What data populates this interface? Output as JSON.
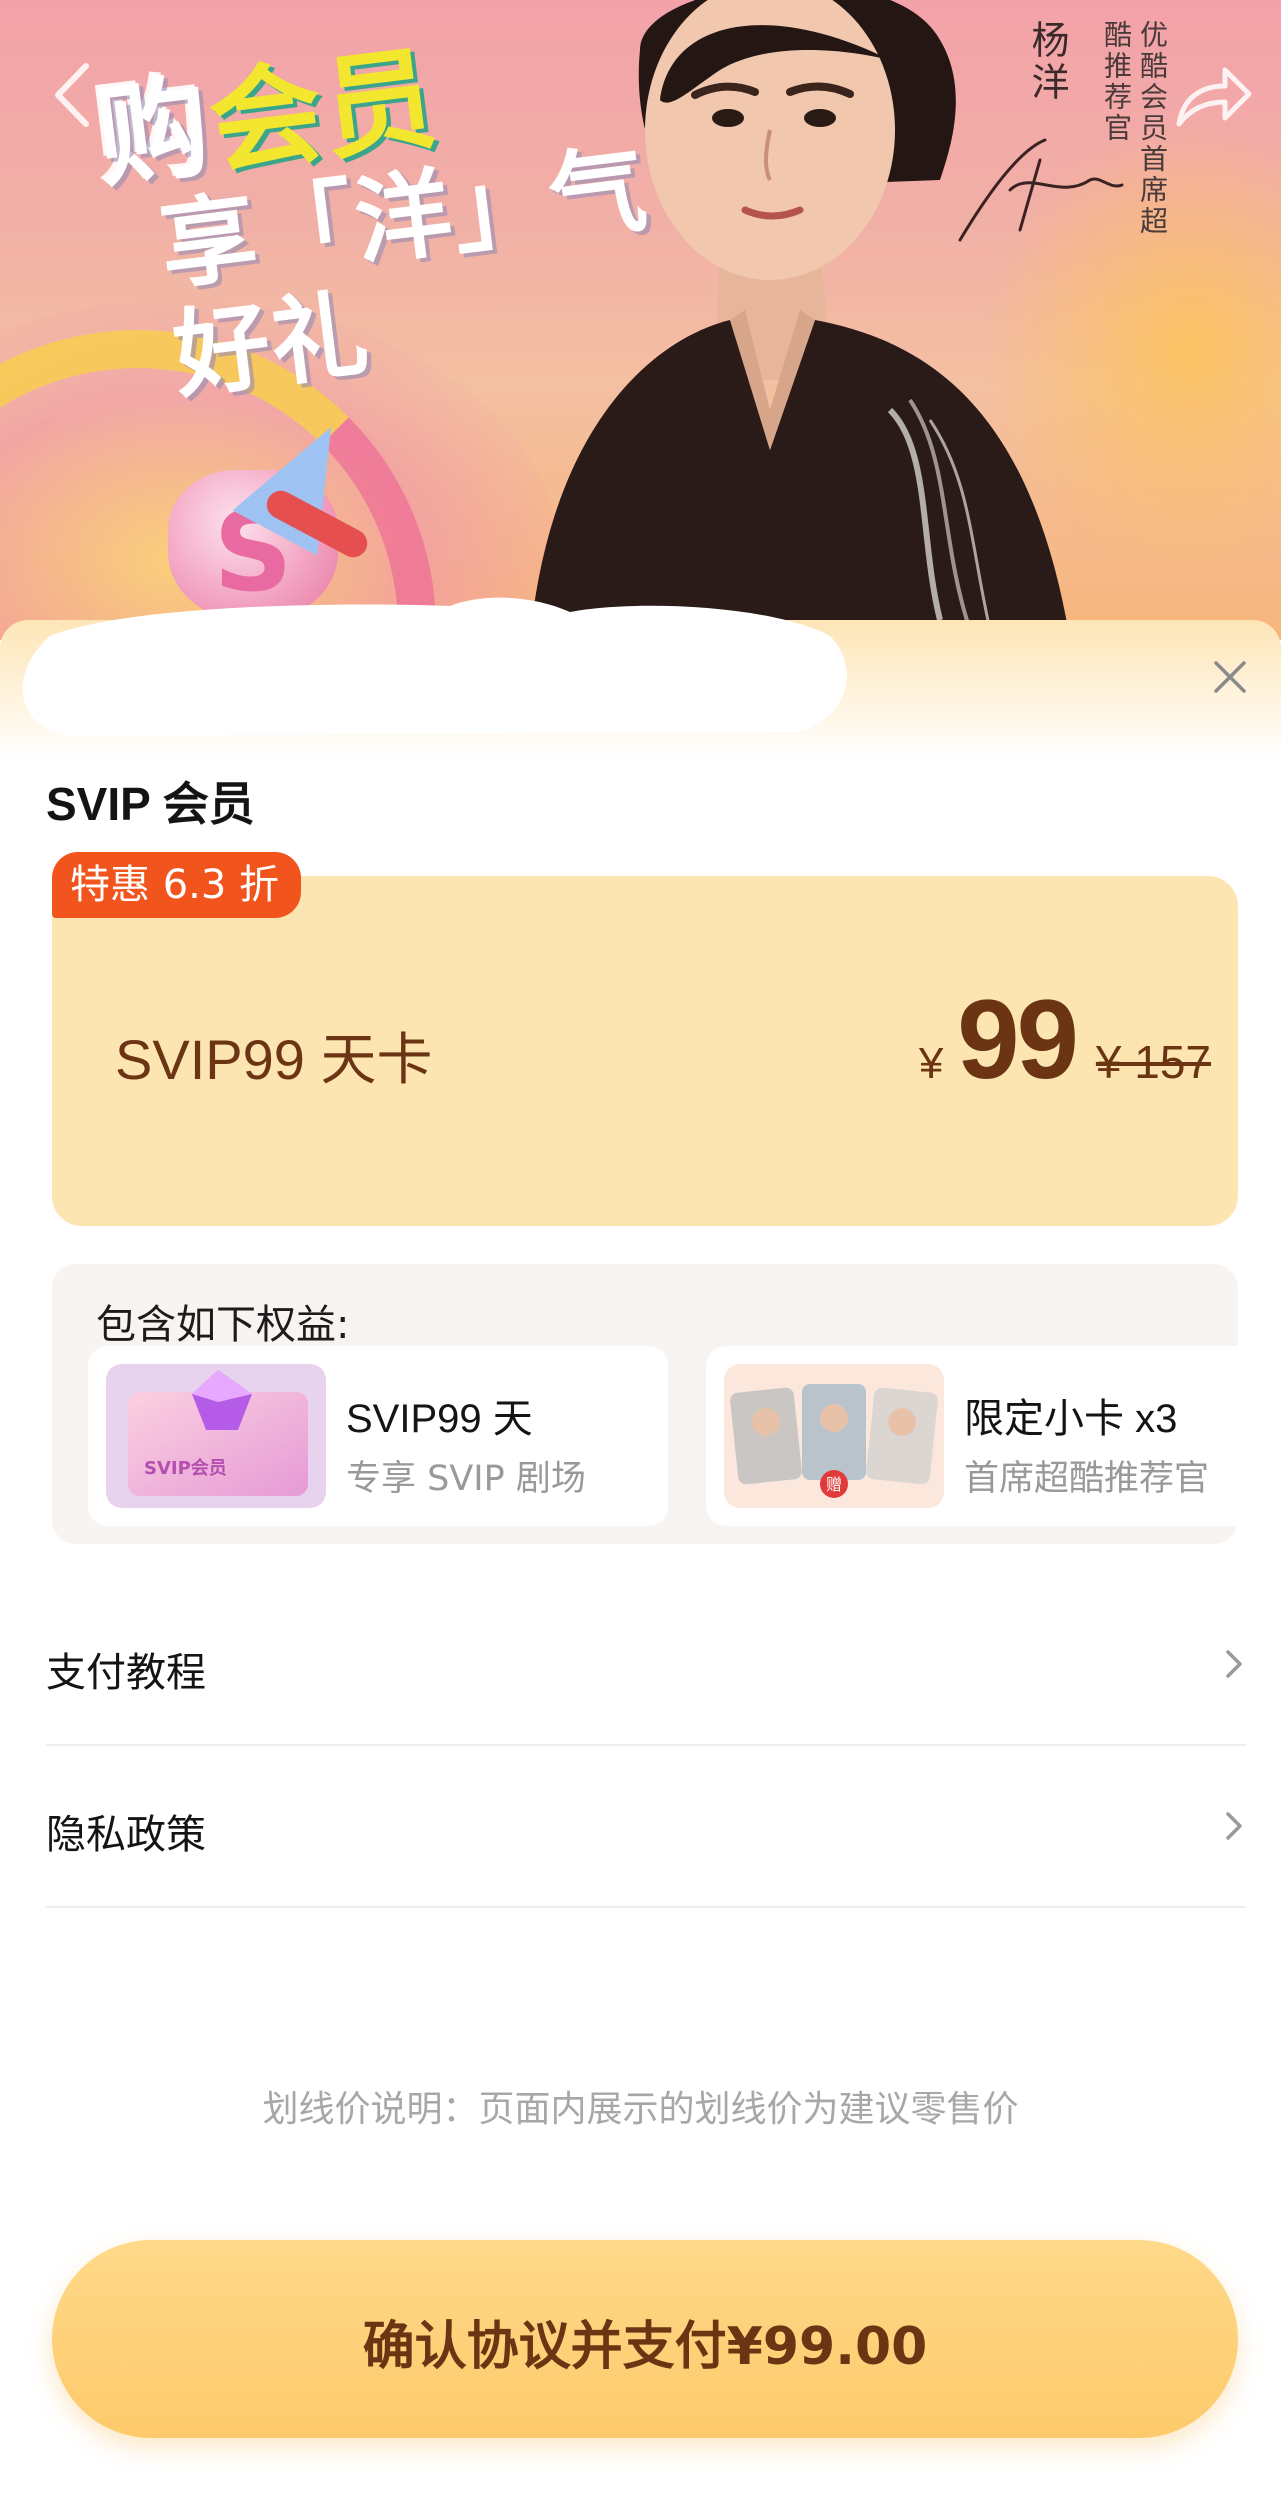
{
  "hero": {
    "promo_line1_a": "购",
    "promo_line1_b": "会员",
    "promo_line2": "享「洋」气好礼",
    "celebrity_name": "杨洋",
    "celebrity_title": "优酷会员首席超酷推荐官",
    "badge_letter": "S"
  },
  "sheet": {
    "section_title": "SVIP 会员",
    "plan": {
      "discount_badge": "特惠 6.3 折",
      "name": "SVIP99 天卡",
      "price_symbol": "¥",
      "price": "99",
      "original_price": "¥ 157"
    },
    "benefits": {
      "title": "包含如下权益:",
      "items": [
        {
          "name": "SVIP99 天",
          "desc": "专享 SVIP 剧场",
          "thumb_label": "SVIP会员",
          "icon": "svip-card-icon"
        },
        {
          "name": "限定小卡 x3",
          "desc": "首席超酷推荐官",
          "thumb_label": "赠",
          "icon": "photo-cards-icon"
        }
      ]
    },
    "menu": [
      {
        "label": "支付教程",
        "icon": "chevron-right-icon"
      },
      {
        "label": "隐私政策",
        "icon": "chevron-right-icon"
      }
    ],
    "strike_note": "划线价说明：页面内展示的划线价为建议零售价",
    "pay_button": "确认协议并支付¥99.00"
  },
  "colors": {
    "accent_brown": "#6b3514",
    "badge_orange": "#f2541d",
    "card_yellow": "#fde5b2",
    "button_yellow": "#fdca6b"
  }
}
